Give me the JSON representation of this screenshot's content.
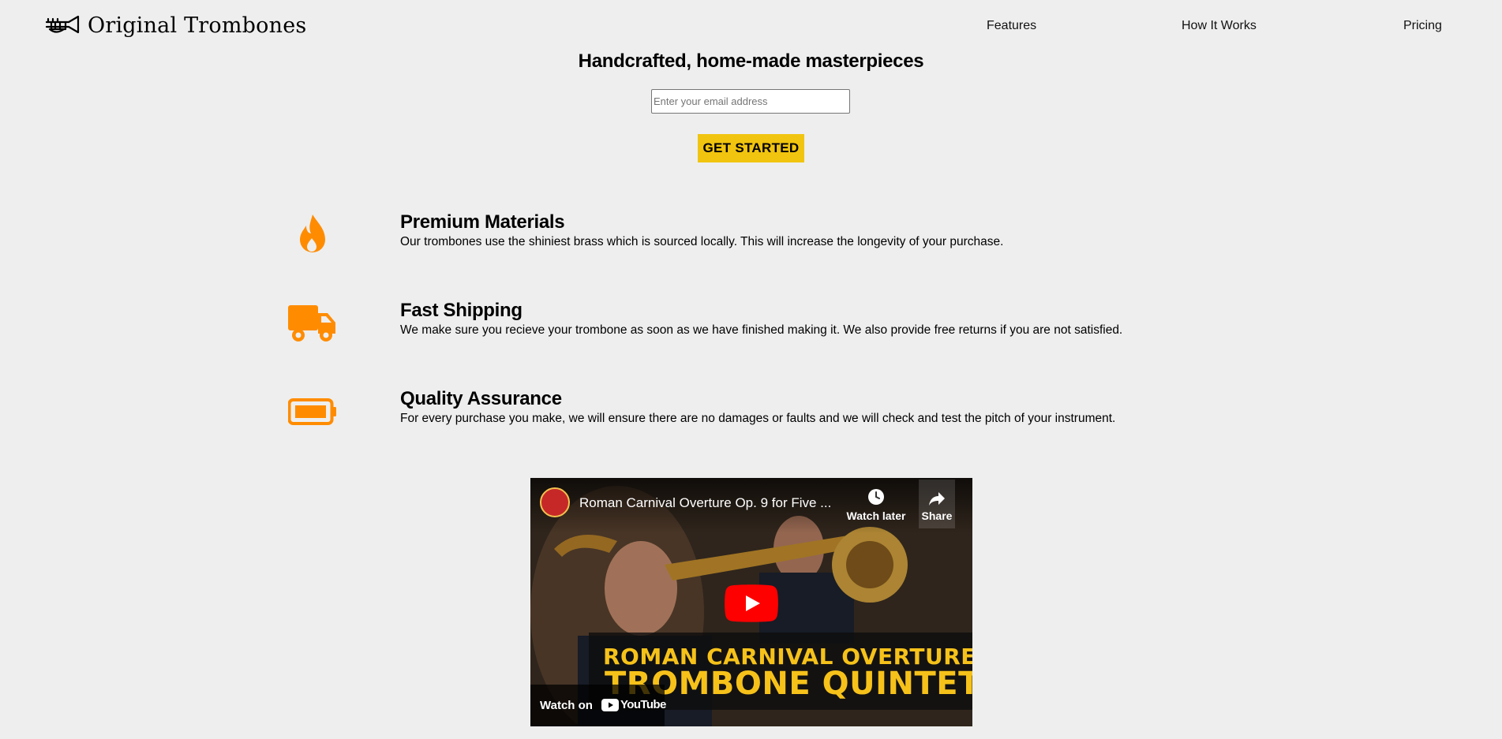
{
  "header": {
    "brand": "Original Trombones",
    "nav": [
      {
        "label": "Features"
      },
      {
        "label": "How It Works"
      },
      {
        "label": "Pricing"
      }
    ]
  },
  "hero": {
    "title": "Handcrafted, home-made masterpieces",
    "email_placeholder": "Enter your email address",
    "cta_label": "GET STARTED"
  },
  "features": [
    {
      "icon": "fire-icon",
      "title": "Premium Materials",
      "description": "Our trombones use the shiniest brass which is sourced locally. This will increase the longevity of your purchase."
    },
    {
      "icon": "truck-icon",
      "title": "Fast Shipping",
      "description": "We make sure you recieve your trombone as soon as we have finished making it. We also provide free returns if you are not satisfied."
    },
    {
      "icon": "battery-icon",
      "title": "Quality Assurance",
      "description": "For every purchase you make, we will ensure there are no damages or faults and we will check and test the pitch of your instrument."
    }
  ],
  "video": {
    "title": "Roman Carnival Overture Op. 9 for Five ...",
    "watch_later": "Watch later",
    "share": "Share",
    "banner_line1": "ROMAN CARNIVAL OVERTURE",
    "banner_line2": "TROMBONE QUINTET",
    "watch_on": "Watch on",
    "youtube": "YouTube"
  },
  "colors": {
    "background": "#eeeeee",
    "accent_icon": "#ff8c00",
    "cta": "#f1c40f"
  }
}
